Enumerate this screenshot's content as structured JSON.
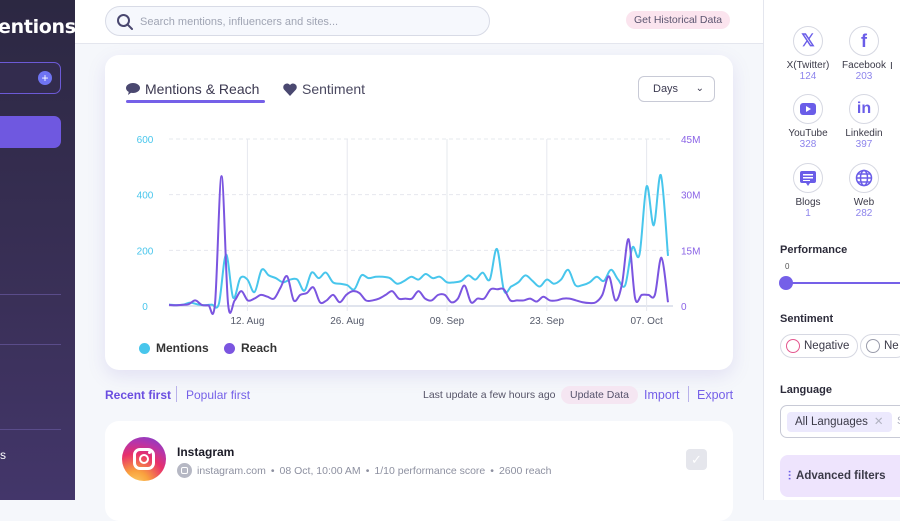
{
  "sidebar": {
    "brand": "entions",
    "bottom_text": "s"
  },
  "topbar": {
    "search_placeholder": "Search mentions, influencers and sites...",
    "historical_button": "Get Historical Data"
  },
  "chart_card": {
    "tabs": [
      {
        "label": "Mentions & Reach",
        "icon": "chat-bubble-icon",
        "active": true
      },
      {
        "label": "Sentiment",
        "icon": "heart-icon",
        "active": false
      }
    ],
    "period_select": "Days"
  },
  "chart_data": {
    "type": "line",
    "title": "",
    "x_tick_labels": [
      "12. Aug",
      "26. Aug",
      "09. Sep",
      "23. Sep",
      "07. Oct"
    ],
    "x_start": "01 Aug",
    "x_end": "08 Oct",
    "left_axis": {
      "label": "Mentions",
      "ticks": [
        "0",
        "200",
        "400",
        "600"
      ],
      "range": [
        0,
        600
      ]
    },
    "right_axis": {
      "label": "Reach",
      "ticks": [
        "0",
        "15M",
        "30M",
        "45M"
      ],
      "range": [
        0,
        45
      ]
    },
    "series": [
      {
        "name": "Mentions",
        "color": "#48c6ec",
        "axis": "left",
        "values": [
          5,
          3,
          5,
          12,
          6,
          3,
          5,
          8,
          185,
          30,
          100,
          95,
          50,
          130,
          110,
          100,
          85,
          95,
          95,
          55,
          120,
          100,
          120,
          85,
          80,
          75,
          60,
          110,
          100,
          105,
          105,
          100,
          80,
          90,
          105,
          95,
          115,
          100,
          105,
          85,
          85,
          90,
          110,
          95,
          120,
          95,
          205,
          55,
          70,
          85,
          110,
          90,
          70,
          95,
          80,
          95,
          130,
          75,
          75,
          85,
          105,
          90,
          130,
          95,
          75,
          210,
          185,
          430,
          290,
          470,
          180
        ],
        "x_days": [
          0,
          1,
          2,
          3,
          4,
          5,
          6,
          7,
          8,
          9,
          10,
          11,
          12,
          13,
          14,
          15,
          16,
          17,
          18,
          19,
          20,
          21,
          22,
          23,
          24,
          25,
          26,
          27,
          28,
          29,
          30,
          31,
          32,
          33,
          34,
          35,
          36,
          37,
          38,
          39,
          40,
          41,
          42,
          43,
          44,
          45,
          46,
          47,
          48,
          49,
          50,
          51,
          52,
          53,
          54,
          55,
          56,
          57,
          58,
          59,
          60,
          61,
          62,
          63,
          64,
          65,
          66,
          67,
          68,
          69,
          70
        ]
      },
      {
        "name": "Reach",
        "color": "#7b55e0",
        "axis": "right",
        "unit": "M",
        "values": [
          0.3,
          0.2,
          0.3,
          0.5,
          1.5,
          0.3,
          0.2,
          0.5,
          35,
          0.5,
          1.5,
          4,
          1.5,
          2,
          3,
          2.5,
          2,
          5,
          8,
          1.5,
          3,
          3.5,
          5,
          1,
          1.5,
          3,
          1,
          3,
          4,
          3.5,
          1.5,
          1.5,
          2,
          3,
          4,
          2,
          2,
          2,
          4,
          2,
          1.5,
          3,
          3,
          1,
          2,
          5.5,
          1,
          2,
          2,
          4.5,
          4.5,
          4.5,
          1.5,
          1.5,
          1.5,
          2,
          1.2,
          2.5,
          1.5,
          1.5,
          2,
          2,
          1.5,
          1,
          0.8,
          1,
          3,
          8,
          1.5,
          6,
          18,
          2,
          3,
          3,
          3,
          13,
          1
        ]
      }
    ],
    "legend": [
      "Mentions",
      "Reach"
    ],
    "legend_position": "bottom-left",
    "grid": true
  },
  "legend": [
    {
      "label": "Mentions",
      "color": "#48c6ec"
    },
    {
      "label": "Reach",
      "color": "#7b55e0"
    }
  ],
  "sortbar": {
    "recent": "Recent first",
    "popular": "Popular first",
    "last_update": "Last update a few hours ago",
    "update_button": "Update Data",
    "import": "Import",
    "export": "Export"
  },
  "mention": {
    "title": "Instagram",
    "source": "instagram.com",
    "date": "08 Oct, 10:00 AM",
    "score": "1/10 performance score",
    "reach": "2600 reach",
    "separator": "•"
  },
  "right_panel": {
    "sources": [
      {
        "name": "X(Twitter)",
        "count": "124",
        "icon": "x-twitter-icon",
        "glyph": "𝕏"
      },
      {
        "name": "Facebook",
        "count": "203",
        "icon": "facebook-icon",
        "glyph": "f"
      },
      {
        "name": "YouTube",
        "count": "328",
        "icon": "youtube-icon",
        "glyph": "▶"
      },
      {
        "name": "Linkedin",
        "count": "397",
        "icon": "linkedin-icon",
        "glyph": "in"
      },
      {
        "name": "Blogs",
        "count": "1",
        "icon": "blog-icon",
        "glyph": "▤"
      },
      {
        "name": "Web",
        "count": "282",
        "icon": "globe-icon",
        "glyph": "🌐"
      }
    ],
    "partial_source_initial": "I",
    "performance_label": "Performance",
    "performance_value": "0",
    "sentiment_label": "Sentiment",
    "sentiment_options": [
      "Negative",
      "Ne"
    ],
    "language_label": "Language",
    "language_value": "All Languages",
    "language_remove": "✕",
    "language_partial": "S",
    "advanced_filters": "Advanced filters"
  }
}
